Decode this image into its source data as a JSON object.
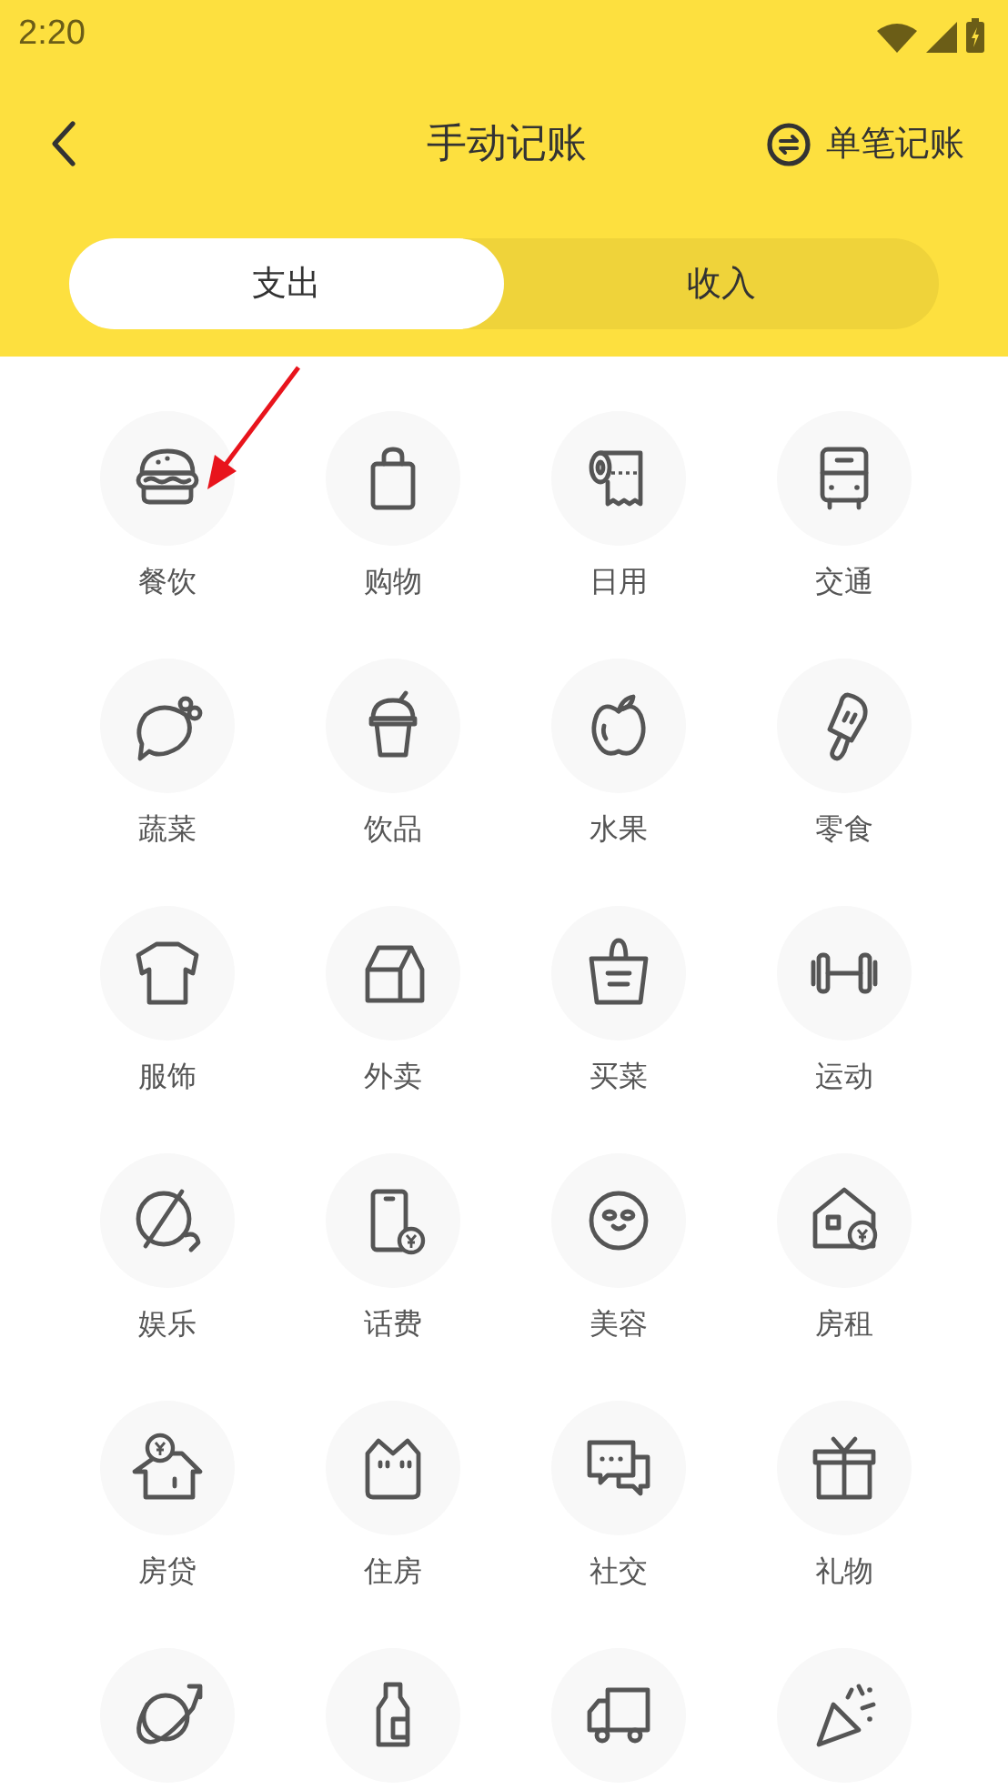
{
  "status_bar": {
    "time": "2:20"
  },
  "header": {
    "title": "手动记账",
    "action": "单笔记账"
  },
  "tabs": [
    {
      "label": "支出",
      "selected": true
    },
    {
      "label": "收入",
      "selected": false
    }
  ],
  "categories": [
    {
      "kind": "labeled",
      "label": "餐饮"
    },
    {
      "kind": "labeled",
      "label": "购物"
    },
    {
      "kind": "labeled",
      "label": "日用"
    },
    {
      "kind": "labeled",
      "label": "交通"
    },
    {
      "kind": "labeled",
      "label": "蔬菜"
    },
    {
      "kind": "labeled",
      "label": "饮品"
    },
    {
      "kind": "labeled",
      "label": "水果"
    },
    {
      "kind": "labeled",
      "label": "零食"
    },
    {
      "kind": "labeled",
      "label": "服饰"
    },
    {
      "kind": "labeled",
      "label": "外卖"
    },
    {
      "kind": "labeled",
      "label": "买菜"
    },
    {
      "kind": "labeled",
      "label": "运动"
    },
    {
      "kind": "labeled",
      "label": "娱乐"
    },
    {
      "kind": "labeled",
      "label": "话费"
    },
    {
      "kind": "labeled",
      "label": "美容"
    },
    {
      "kind": "labeled",
      "label": "房租"
    },
    {
      "kind": "labeled",
      "label": "房贷"
    },
    {
      "kind": "labeled",
      "label": "住房"
    },
    {
      "kind": "labeled",
      "label": "社交"
    },
    {
      "kind": "labeled",
      "label": "礼物"
    },
    {
      "kind": "icon-only"
    },
    {
      "kind": "icon-only"
    },
    {
      "kind": "icon-only"
    },
    {
      "kind": "icon-only"
    }
  ]
}
